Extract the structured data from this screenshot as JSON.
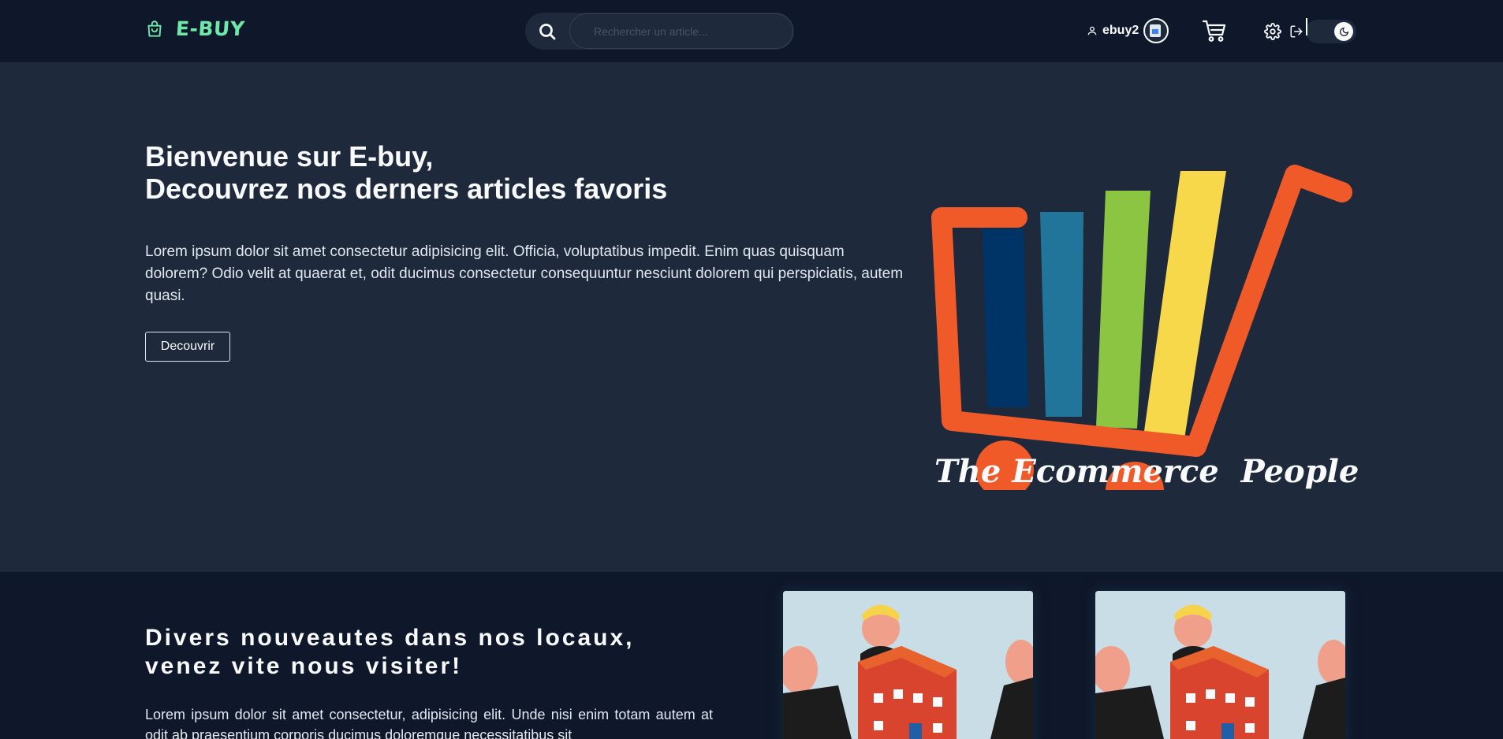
{
  "navbar": {
    "brand_name": "E-BUY",
    "search_placeholder": "Rechercher un article...",
    "username": "ebuy2"
  },
  "hero": {
    "title_line1": "Bienvenue sur E-buy,",
    "title_line2": "Decouvrez nos derners articles favoris",
    "text": "Lorem ipsum dolor sit amet consectetur adipisicing elit. Officia, voluptatibus impedit. Enim quas quisquam dolorem? Odio velit at quaerat et, odit ducimus consectetur consequuntur nesciunt dolorem qui perspiciatis, autem quasi.",
    "button_label": "Decouvrir",
    "logo_tagline": "The Ecommerce  People"
  },
  "section2": {
    "title_line1": "Divers nouveautes dans nos locaux,",
    "title_line2": "venez vite nous visiter!",
    "text": "Lorem ipsum dolor sit amet consectetur, adipisicing elit. Unde nisi enim totam autem at odit ab praesentium corporis ducimus doloremque necessitatibus sit"
  },
  "colors": {
    "brand": "#6ee7a8",
    "nav_bg": "#0f172a",
    "hero_bg": "#1e293b",
    "cart_orange": "#f05a28",
    "bar_navy": "#003366",
    "bar_teal": "#21759b",
    "bar_green": "#8bc541",
    "bar_yellow": "#f6d84a"
  }
}
